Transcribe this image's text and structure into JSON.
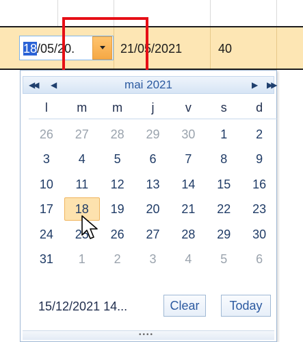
{
  "row": {
    "start_date_value": "18/05/20.",
    "start_date_selected_part": "18",
    "start_date_rest": "/05/20.",
    "end_date": "21/05/2021",
    "count": "40"
  },
  "calendar": {
    "month_title": "mai 2021",
    "nav": {
      "prev_year": "◀◀",
      "prev_month": "◀",
      "next_month": "▶",
      "next_year": "▶▶"
    },
    "weekdays": [
      "l",
      "m",
      "m",
      "j",
      "v",
      "s",
      "d"
    ],
    "weeks": [
      [
        {
          "d": "26",
          "o": true
        },
        {
          "d": "27",
          "o": true
        },
        {
          "d": "28",
          "o": true
        },
        {
          "d": "29",
          "o": true
        },
        {
          "d": "30",
          "o": true
        },
        {
          "d": "1",
          "o": false
        },
        {
          "d": "2",
          "o": false
        }
      ],
      [
        {
          "d": "3",
          "o": false
        },
        {
          "d": "4",
          "o": false
        },
        {
          "d": "5",
          "o": false
        },
        {
          "d": "6",
          "o": false
        },
        {
          "d": "7",
          "o": false
        },
        {
          "d": "8",
          "o": false
        },
        {
          "d": "9",
          "o": false
        }
      ],
      [
        {
          "d": "10",
          "o": false
        },
        {
          "d": "11",
          "o": false
        },
        {
          "d": "12",
          "o": false
        },
        {
          "d": "13",
          "o": false
        },
        {
          "d": "14",
          "o": false
        },
        {
          "d": "15",
          "o": false
        },
        {
          "d": "16",
          "o": false
        }
      ],
      [
        {
          "d": "17",
          "o": false
        },
        {
          "d": "18",
          "o": false,
          "today": true
        },
        {
          "d": "19",
          "o": false
        },
        {
          "d": "20",
          "o": false
        },
        {
          "d": "21",
          "o": false
        },
        {
          "d": "22",
          "o": false
        },
        {
          "d": "23",
          "o": false
        }
      ],
      [
        {
          "d": "24",
          "o": false
        },
        {
          "d": "25",
          "o": false
        },
        {
          "d": "26",
          "o": false
        },
        {
          "d": "27",
          "o": false
        },
        {
          "d": "28",
          "o": false
        },
        {
          "d": "29",
          "o": false
        },
        {
          "d": "30",
          "o": false
        }
      ],
      [
        {
          "d": "31",
          "o": false
        },
        {
          "d": "1",
          "o": true
        },
        {
          "d": "2",
          "o": true
        },
        {
          "d": "3",
          "o": true
        },
        {
          "d": "4",
          "o": true
        },
        {
          "d": "5",
          "o": true
        },
        {
          "d": "6",
          "o": true
        }
      ]
    ],
    "footer_text": "15/12/2021 14...",
    "clear_label": "Clear",
    "today_label": "Today"
  },
  "colors": {
    "row_highlight": "#fde6b4",
    "dropdown_button": "#f5a845",
    "focus_frame": "#e60f16",
    "calendar_accent": "#2c5aa0"
  }
}
